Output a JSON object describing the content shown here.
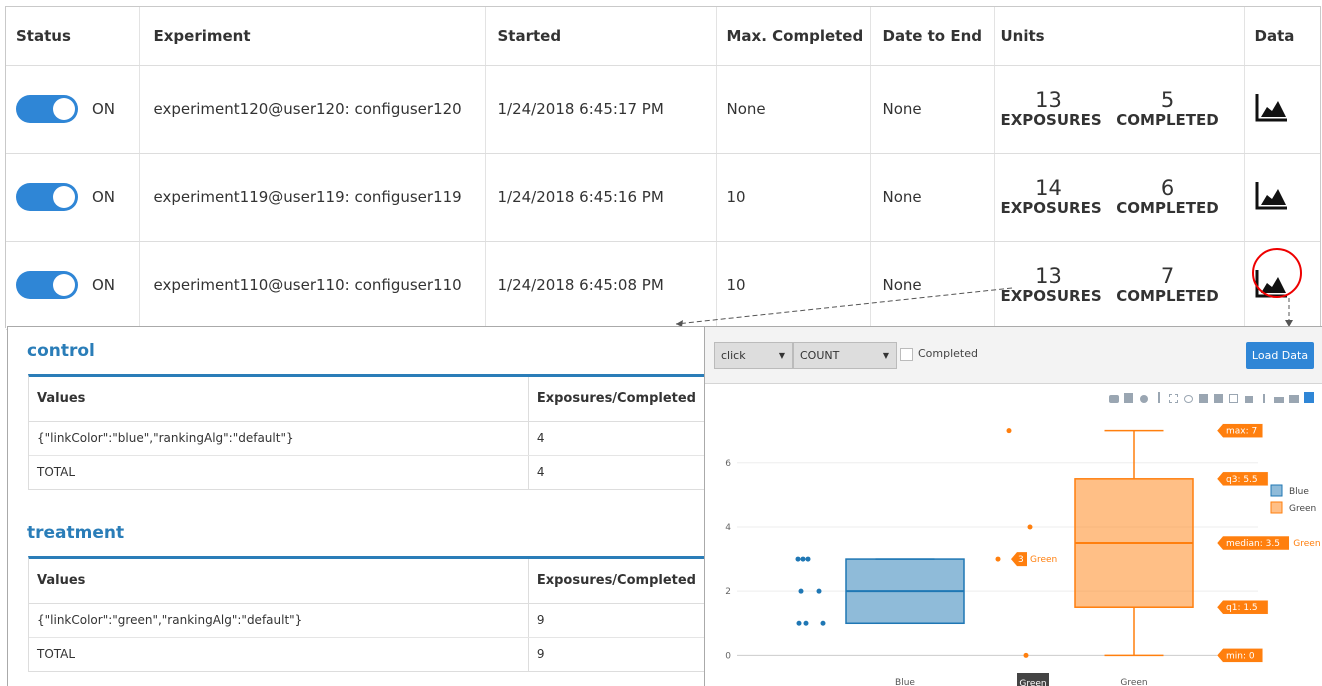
{
  "columns": {
    "status": "Status",
    "experiment": "Experiment",
    "started": "Started",
    "max_completed": "Max. Completed",
    "date_to_end": "Date to End",
    "units": "Units",
    "data": "Data"
  },
  "rows": [
    {
      "status": "ON",
      "experiment": "experiment120@user120: configuser120",
      "started": "1/24/2018 6:45:17 PM",
      "max_completed": "None",
      "date_to_end": "None",
      "exposures": "13",
      "exposures_label": "EXPOSURES",
      "completed": "5",
      "completed_label": "COMPLETED"
    },
    {
      "status": "ON",
      "experiment": "experiment119@user119: configuser119",
      "started": "1/24/2018 6:45:16 PM",
      "max_completed": "10",
      "date_to_end": "None",
      "exposures": "14",
      "exposures_label": "EXPOSURES",
      "completed": "6",
      "completed_label": "COMPLETED"
    },
    {
      "status": "ON",
      "experiment": "experiment110@user110: configuser110",
      "started": "1/24/2018 6:45:08 PM",
      "max_completed": "10",
      "date_to_end": "None",
      "exposures": "13",
      "exposures_label": "EXPOSURES",
      "completed": "7",
      "completed_label": "COMPLETED"
    }
  ],
  "groups": [
    {
      "title": "control",
      "col_values": "Values",
      "col_counts": "Exposures/Completed",
      "rows": [
        {
          "value": "{\"linkColor\":\"blue\",\"rankingAlg\":\"default\"}",
          "count": "4"
        },
        {
          "value": "TOTAL",
          "count": "4"
        }
      ]
    },
    {
      "title": "treatment",
      "col_values": "Values",
      "col_counts": "Exposures/Completed",
      "rows": [
        {
          "value": "{\"linkColor\":\"green\",\"rankingAlg\":\"default\"}",
          "count": "9"
        },
        {
          "value": "TOTAL",
          "count": "9"
        }
      ]
    }
  ],
  "chart_panel": {
    "event_select": "click",
    "agg_select": "COUNT",
    "completed_label": "Completed",
    "load_button": "Load Data"
  },
  "colors": {
    "accent": "#2f86d6",
    "header_blue": "#2a7db8",
    "blue_series": "#1f77b4",
    "orange_series": "#ff7f0e",
    "annotation_red": "#e00000"
  },
  "chart_data": {
    "type": "box",
    "categories": [
      "Blue",
      "Green"
    ],
    "yticks": [
      0,
      2,
      4,
      6
    ],
    "ylim": [
      -0.3,
      7.8
    ],
    "legend": [
      "Blue",
      "Green"
    ],
    "series": [
      {
        "name": "Blue",
        "color": "#1f77b4",
        "q1": 1,
        "median": 2,
        "q3": 3,
        "min": 1,
        "max": 3,
        "points": [
          1,
          1,
          1,
          2,
          2,
          3,
          3,
          3
        ]
      },
      {
        "name": "Green",
        "color": "#ff7f0e",
        "q1": 1.5,
        "median": 3.5,
        "q3": 5.5,
        "min": 0,
        "max": 7,
        "points": [
          0,
          3,
          4,
          7
        ]
      }
    ],
    "hover_labels": [
      "max: 7",
      "q3: 5.5",
      "median: 3.5",
      "q1: 1.5",
      "min: 0"
    ],
    "median_series_label": "Green",
    "point_label_value": "3",
    "point_label_series": "Green",
    "x_hover_label": "Green"
  }
}
